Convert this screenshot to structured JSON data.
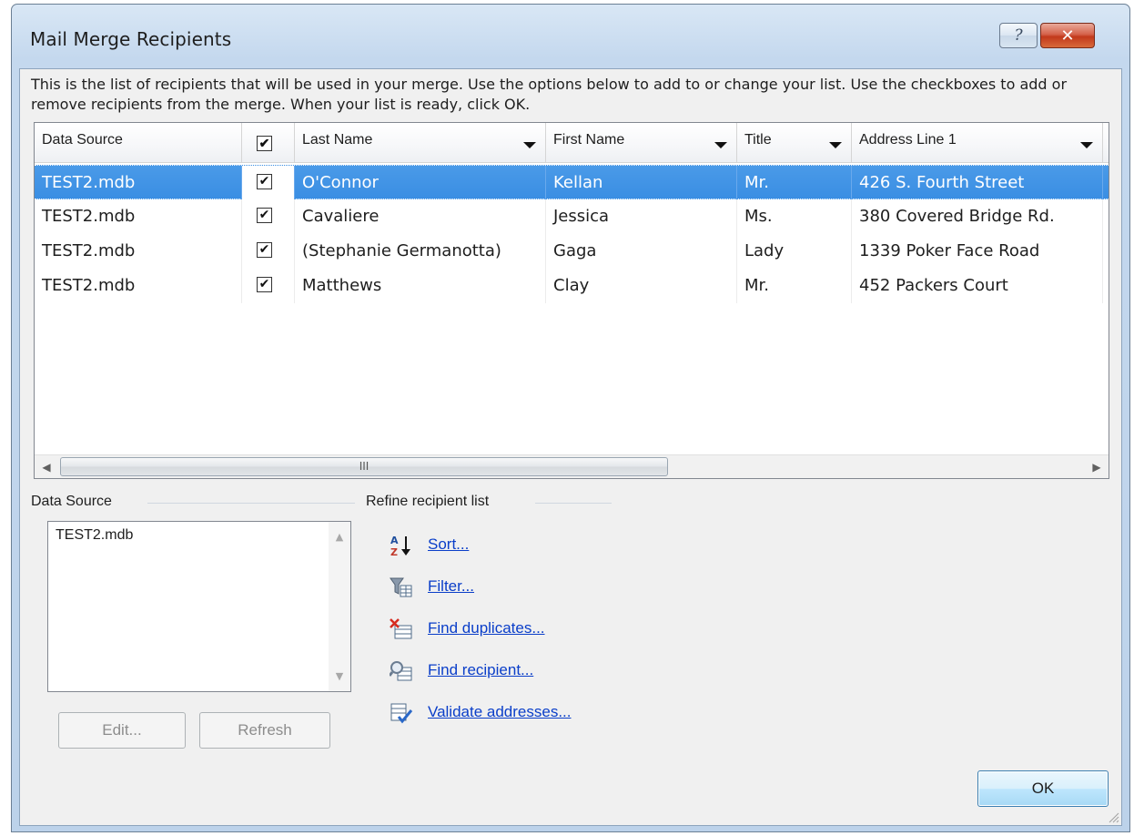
{
  "window": {
    "title": "Mail Merge Recipients",
    "help_glyph": "?",
    "close_glyph": "✕"
  },
  "intro_text": "This is the list of recipients that will be used in your merge.  Use the options below to add to or change your list.  Use the checkboxes to add or remove recipients from the merge.  When your list is ready, click OK.",
  "grid": {
    "columns": [
      "Data Source",
      "",
      "Last Name",
      "First Name",
      "Title",
      "Address Line 1"
    ],
    "rows": [
      {
        "source": "TEST2.mdb",
        "checked": true,
        "last": "O'Connor",
        "first": "Kellan",
        "title": "Mr.",
        "address": "426 S. Fourth Street",
        "selected": true
      },
      {
        "source": "TEST2.mdb",
        "checked": true,
        "last": "Cavaliere",
        "first": "Jessica",
        "title": "Ms.",
        "address": "380 Covered Bridge Rd.",
        "selected": false
      },
      {
        "source": "TEST2.mdb",
        "checked": true,
        "last": "(Stephanie Germanotta)",
        "first": "Gaga",
        "title": "Lady",
        "address": "1339 Poker Face Road",
        "selected": false
      },
      {
        "source": "TEST2.mdb",
        "checked": true,
        "last": "Matthews",
        "first": "Clay",
        "title": "Mr.",
        "address": "452 Packers Court",
        "selected": false
      }
    ],
    "check_glyph": "✔",
    "scroll_left_glyph": "◀",
    "scroll_right_glyph": "▶",
    "thumb_glyph": "III"
  },
  "data_source_group": {
    "label": "Data Source",
    "items": [
      "TEST2.mdb"
    ],
    "edit_label": "Edit...",
    "refresh_label": "Refresh"
  },
  "refine_group": {
    "label": "Refine recipient list",
    "links": [
      {
        "label": "Sort...",
        "icon": "sort-az-icon"
      },
      {
        "label": "Filter...",
        "icon": "filter-icon"
      },
      {
        "label": "Find duplicates...",
        "icon": "find-duplicates-icon"
      },
      {
        "label": "Find recipient...",
        "icon": "find-recipient-icon"
      },
      {
        "label": "Validate addresses...",
        "icon": "validate-addresses-icon"
      }
    ]
  },
  "ok_label": "OK",
  "colors": {
    "selection": "#3a8ee3",
    "link": "#0a3ec9",
    "client_bg": "#f0f0f0",
    "frame": "#c4d8ee"
  }
}
